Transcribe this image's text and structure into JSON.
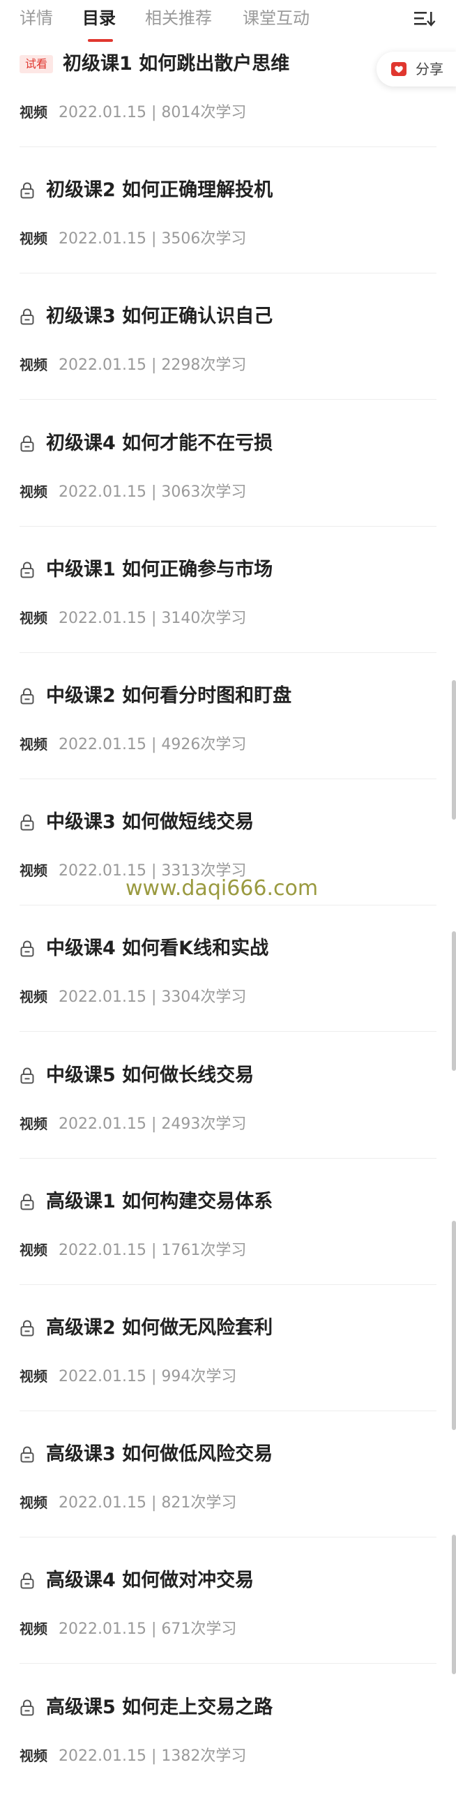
{
  "tabs": [
    {
      "label": "详情",
      "active": false
    },
    {
      "label": "目录",
      "active": true
    },
    {
      "label": "相关推荐",
      "active": false
    },
    {
      "label": "课堂互动",
      "active": false
    }
  ],
  "menu_icon": "list-sort-icon",
  "share": {
    "label": "分享",
    "icon": "share-heart-icon"
  },
  "accent_color": "#e0372f",
  "watermark": "www.daqi666.com",
  "lessons": [
    {
      "title": "初级课1 如何跳出散户思维",
      "badge": "试看",
      "type": "视频",
      "info": "2022.01.15 | 8014次学习"
    },
    {
      "title": "初级课2 如何正确理解投机",
      "type": "视频",
      "info": "2022.01.15 | 3506次学习"
    },
    {
      "title": "初级课3 如何正确认识自己",
      "type": "视频",
      "info": "2022.01.15 | 2298次学习"
    },
    {
      "title": "初级课4 如何才能不在亏损",
      "type": "视频",
      "info": "2022.01.15 | 3063次学习"
    },
    {
      "title": "中级课1 如何正确参与市场",
      "type": "视频",
      "info": "2022.01.15 | 3140次学习"
    },
    {
      "title": "中级课2 如何看分时图和盯盘",
      "type": "视频",
      "info": "2022.01.15 | 4926次学习"
    },
    {
      "title": "中级课3 如何做短线交易",
      "type": "视频",
      "info": "2022.01.15 | 3313次学习"
    },
    {
      "title": "中级课4 如何看K线和实战",
      "type": "视频",
      "info": "2022.01.15 | 3304次学习"
    },
    {
      "title": "中级课5 如何做长线交易",
      "type": "视频",
      "info": "2022.01.15 | 2493次学习"
    },
    {
      "title": "高级课1 如何构建交易体系",
      "type": "视频",
      "info": "2022.01.15 | 1761次学习"
    },
    {
      "title": "高级课2 如何做无风险套利",
      "type": "视频",
      "info": "2022.01.15 | 994次学习"
    },
    {
      "title": "高级课3 如何做低风险交易",
      "type": "视频",
      "info": "2022.01.15 | 821次学习"
    },
    {
      "title": "高级课4 如何做对冲交易",
      "type": "视频",
      "info": "2022.01.15 | 671次学习"
    },
    {
      "title": "高级课5 如何走上交易之路",
      "type": "视频",
      "info": "2022.01.15 | 1382次学习"
    }
  ]
}
